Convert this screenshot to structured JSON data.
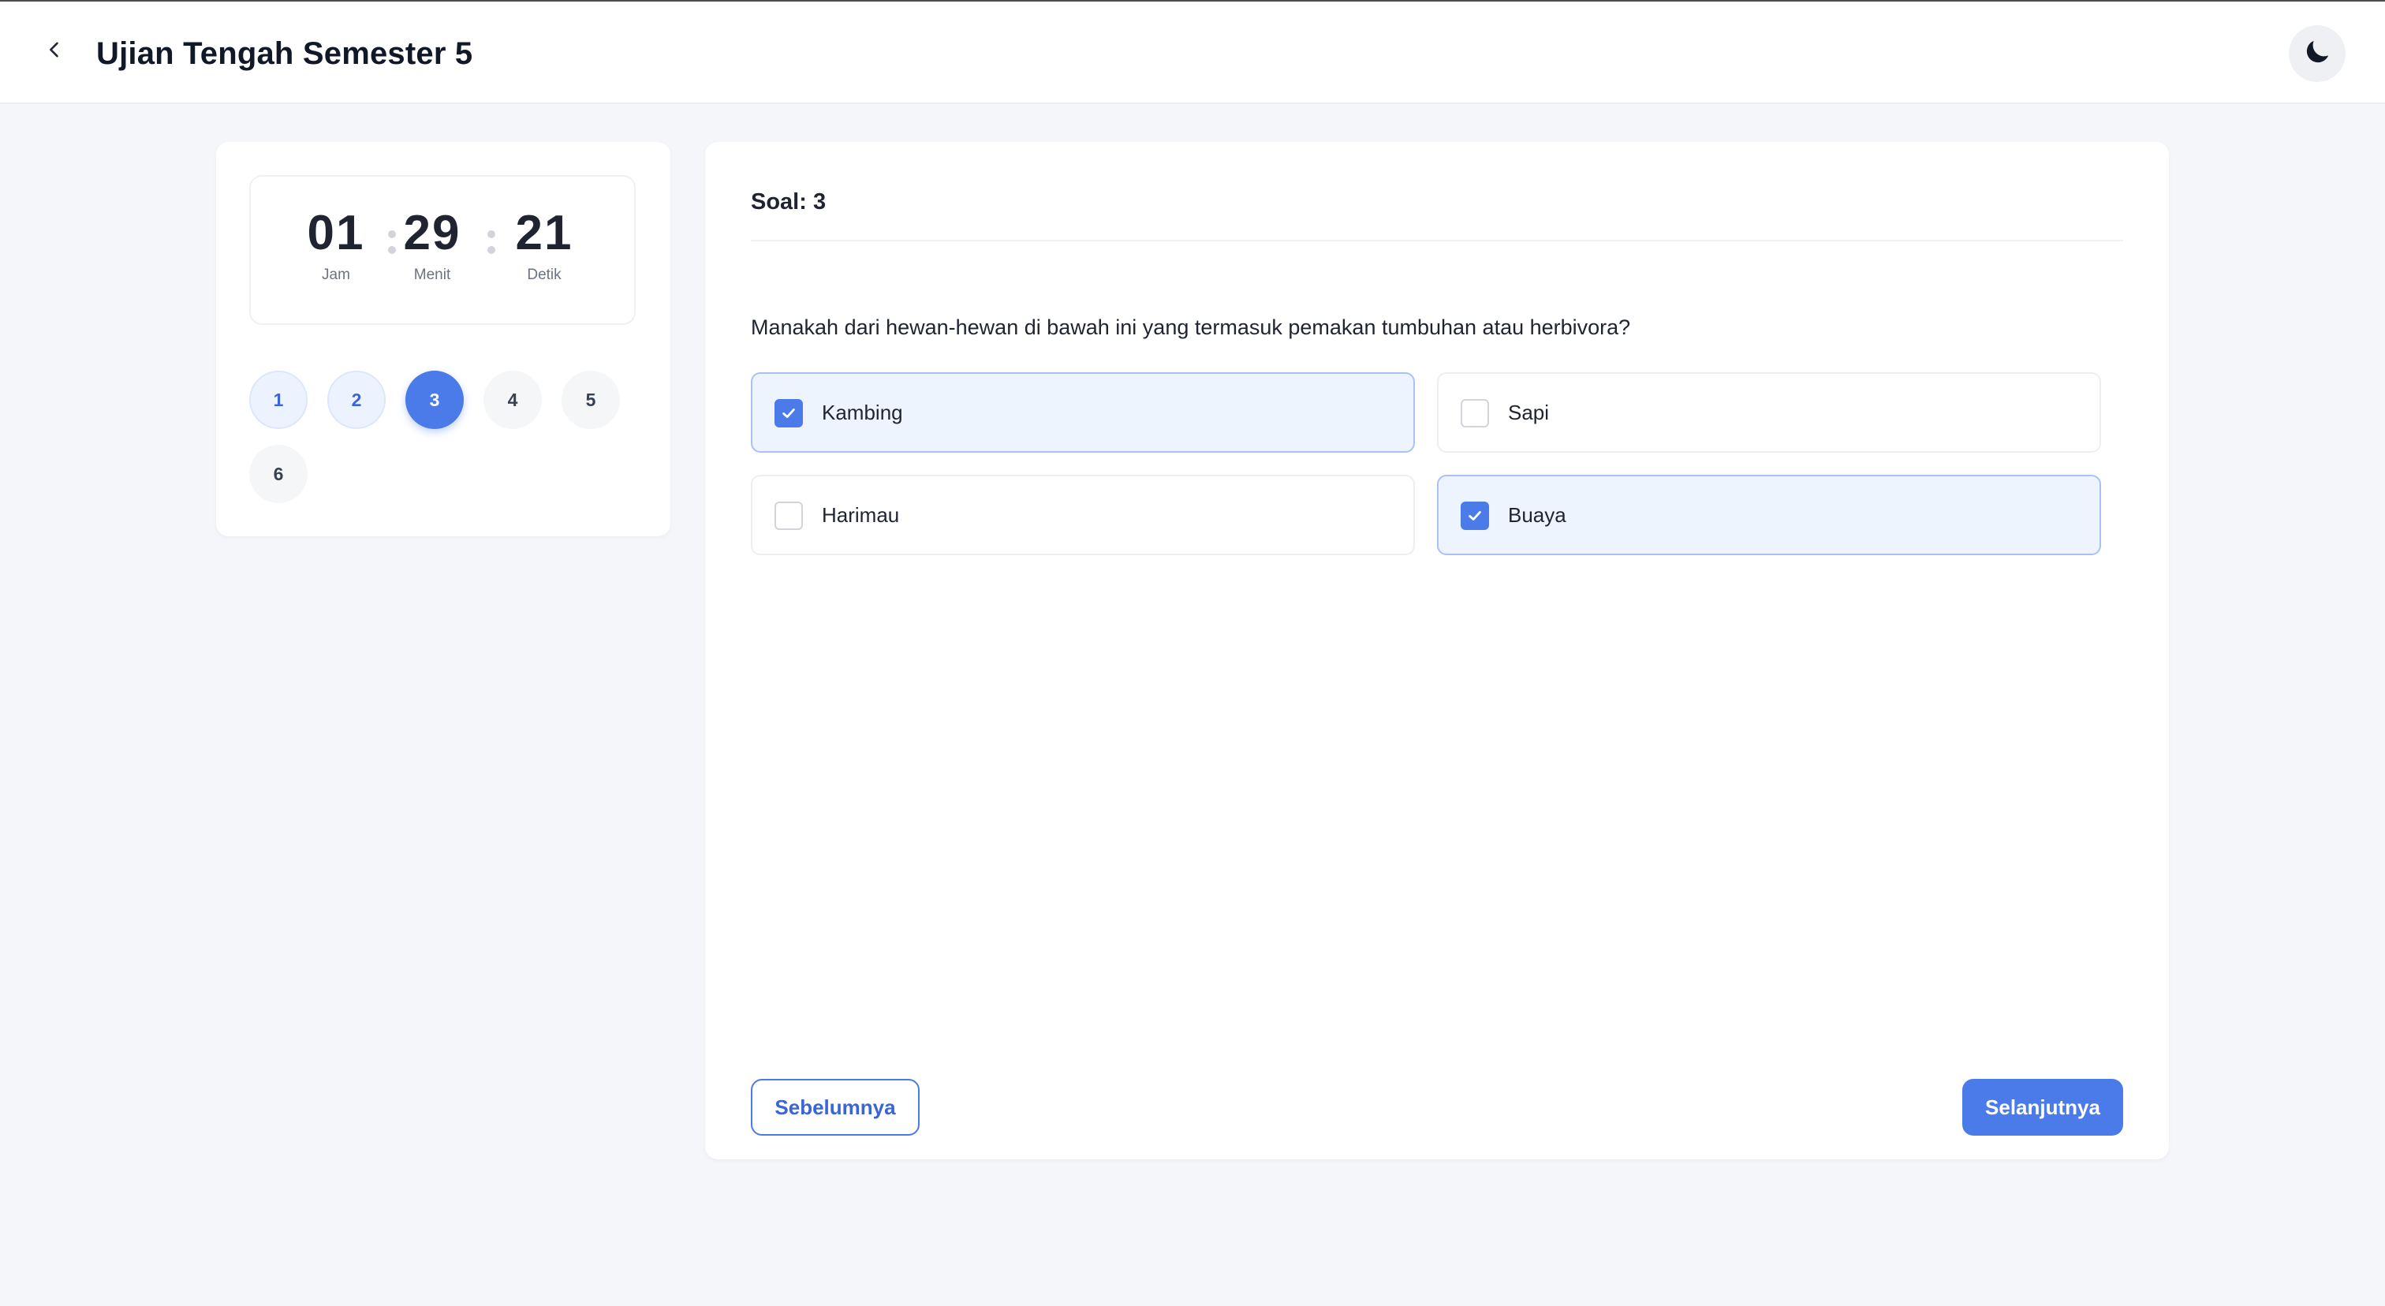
{
  "header": {
    "title": "Ujian Tengah Semester 5",
    "back_icon": "chevron-left-icon",
    "theme_icon": "moon-icon"
  },
  "timer": {
    "hours": "01",
    "minutes": "29",
    "seconds": "21",
    "hours_label": "Jam",
    "minutes_label": "Menit",
    "seconds_label": "Detik"
  },
  "navigator": {
    "items": [
      {
        "label": "1",
        "state": "answered"
      },
      {
        "label": "2",
        "state": "answered"
      },
      {
        "label": "3",
        "state": "current"
      },
      {
        "label": "4",
        "state": "empty"
      },
      {
        "label": "5",
        "state": "empty"
      },
      {
        "label": "6",
        "state": "empty"
      }
    ]
  },
  "question": {
    "number_label": "Soal: 3",
    "text": "Manakah dari hewan-hewan di bawah ini yang termasuk pemakan tumbuhan atau herbivora?",
    "options": [
      {
        "label": "Kambing",
        "checked": true
      },
      {
        "label": "Sapi",
        "checked": false
      },
      {
        "label": "Harimau",
        "checked": false
      },
      {
        "label": "Buaya",
        "checked": true
      }
    ]
  },
  "footer": {
    "prev_label": "Sebelumnya",
    "next_label": "Selanjutnya"
  },
  "colors": {
    "accent": "#4a7be8",
    "selected_bg": "#eef4fe",
    "page_bg": "#f4f6f9"
  }
}
